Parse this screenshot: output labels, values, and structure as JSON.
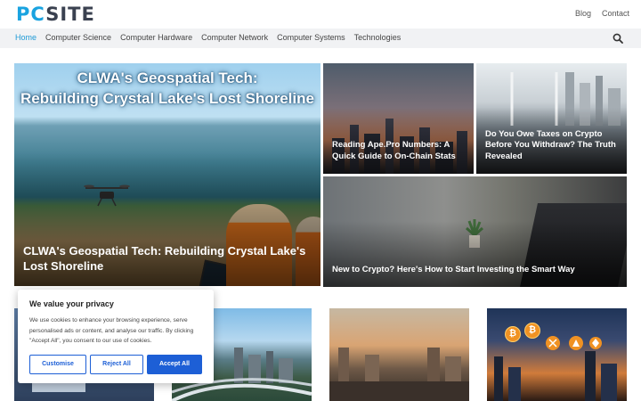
{
  "header": {
    "logo_text": "PCSITE",
    "top_links": [
      "Blog",
      "Contact"
    ]
  },
  "nav": {
    "items": [
      "Home",
      "Computer Science",
      "Computer Hardware",
      "Computer Network",
      "Computer Systems",
      "Technologies"
    ],
    "active": "Home",
    "search_icon": "search-icon"
  },
  "featured": {
    "hero": {
      "banner_line1": "CLWA's Geospatial Tech:",
      "banner_line2": "Rebuilding Crystal Lake's Lost Shoreline",
      "title": "CLWA's Geospatial Tech: Rebuilding Crystal Lake's Lost Shoreline"
    },
    "cards": [
      {
        "title": "Reading Ape.Pro Numbers: A Quick Guide to On-Chain Stats"
      },
      {
        "title": "Do You Owe Taxes on Crypto Before You Withdraw? The Truth Revealed"
      },
      {
        "title": "New to Crypto? Here's How to Start Investing the Smart Way"
      }
    ]
  },
  "thumbs": {
    "coin_symbols": [
      "₿",
      "₿"
    ]
  },
  "cookie": {
    "title": "We value your privacy",
    "text": "We use cookies to enhance your browsing experience, serve personalised ads or content, and analyse our traffic. By clicking \"Accept All\", you consent to our use of cookies.",
    "customise": "Customise",
    "reject": "Reject All",
    "accept": "Accept All"
  },
  "colors": {
    "accent": "#1e9ad6",
    "cookie_button": "#1d5fd6"
  }
}
